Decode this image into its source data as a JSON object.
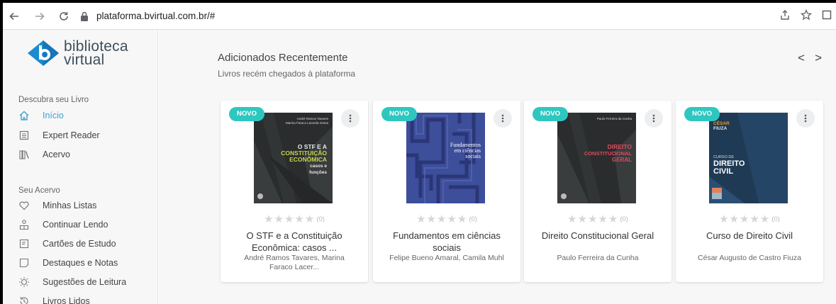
{
  "browser": {
    "url": "plataforma.bvirtual.com.br/#"
  },
  "logo": {
    "line1": "biblioteca",
    "line2": "virtual"
  },
  "sidebar": {
    "section1": "Descubra seu Livro",
    "items1": [
      {
        "label": "Início",
        "icon": "home-icon"
      },
      {
        "label": "Expert Reader",
        "icon": "reader-icon"
      },
      {
        "label": "Acervo",
        "icon": "library-icon"
      }
    ],
    "section2": "Seu Acervo",
    "items2": [
      {
        "label": "Minhas Listas",
        "icon": "heart-icon"
      },
      {
        "label": "Continuar Lendo",
        "icon": "person-book-icon"
      },
      {
        "label": "Cartões de Estudo",
        "icon": "cards-icon"
      },
      {
        "label": "Destaques e Notas",
        "icon": "note-icon"
      },
      {
        "label": "Sugestões de Leitura",
        "icon": "lightbulb-icon"
      },
      {
        "label": "Livros Lidos",
        "icon": "history-icon"
      }
    ]
  },
  "main": {
    "title": "Adicionados Recentemente",
    "subtitle": "Livros recém chegados à plataforma",
    "prev": "<",
    "next": ">"
  },
  "books": [
    {
      "badge": "NOVO",
      "title": "O STF e a Constituição Econômica: casos ...",
      "author": "André Ramos Tavares, Marina Faraco Lacer...",
      "stars": "★★★★★",
      "rating_count": "(0)",
      "cover": {
        "authors": "André Ramos Tavares\nMarina Faraco Lacerda Gama",
        "line1": "O STF E A",
        "line2": "CONSTITUIÇÃO",
        "line3": "ECONÔMICA",
        "line4": "casos e",
        "line5": "funções"
      }
    },
    {
      "badge": "NOVO",
      "title": "Fundamentos em ciências sociais",
      "author": "Felipe Bueno Amaral, Camila Muhl",
      "stars": "★★★★★",
      "rating_count": "(0)",
      "cover": {
        "line1": "Fundamentos",
        "line2": "em ciências",
        "line3": "sociais"
      }
    },
    {
      "badge": "NOVO",
      "title": "Direito Constitucional Geral",
      "author": "Paulo Ferreira da Cunha",
      "stars": "★★★★★",
      "rating_count": "(0)",
      "cover": {
        "author": "Paulo Ferreira da Cunha",
        "line1": "DIREITO",
        "line2": "CONSTITUCIONAL",
        "line3": "GERAL"
      }
    },
    {
      "badge": "NOVO",
      "title": "Curso de Direito Civil",
      "author": "César Augusto de Castro Fiuza",
      "stars": "★★★★★",
      "rating_count": "(0)",
      "cover": {
        "author1": "CÉSAR",
        "author2": "FIUZA",
        "pre": "CURSO DE",
        "line1": "DIREITO",
        "line2": "CIVIL"
      }
    }
  ],
  "colors": {
    "accent": "#3aa3d7",
    "badge": "#2ec7c0",
    "logo_blue": "#1b8bd1"
  }
}
